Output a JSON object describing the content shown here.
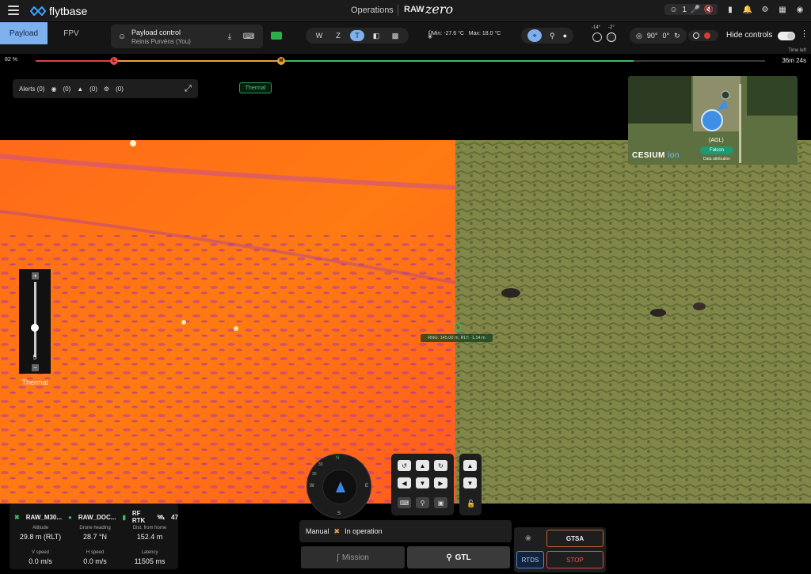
{
  "header": {
    "brand": "flytbase",
    "section": "Operations",
    "drone_prefix": "RAW",
    "drone_name": "zero",
    "user_count": "1"
  },
  "tabs": [
    {
      "label": "Payload",
      "active": true
    },
    {
      "label": "FPV",
      "active": false
    }
  ],
  "payload": {
    "title": "Payload control",
    "user": "Reinis Purvēns (You)"
  },
  "camera_modes": [
    "W",
    "Z",
    "T"
  ],
  "camera_mode_selected": "T",
  "temperature": {
    "min": "Min: -27.6 °C",
    "max": "Max: 18.0 °C"
  },
  "gimbal": {
    "pitch": "-14°",
    "yaw": "-2°",
    "angle1": "90°",
    "angle2": "0°"
  },
  "hide_controls": "Hide controls",
  "progress": {
    "battery_pct": "82 %",
    "marker_low": "L",
    "marker_mid": "M",
    "time_left_label": "Time left",
    "time_left": "36m 24s"
  },
  "alerts": {
    "label": "Alerts (0)",
    "c1": "(0)",
    "c2": "(0)",
    "c3": "(0)"
  },
  "thermal_badge": "Thermal",
  "minimap": {
    "provider": "CESIUM",
    "provider_suffix": "ion",
    "altitude_tag": "(AGL)",
    "drone_label": "Falcon",
    "attribution": "Data attribution"
  },
  "zoom": {
    "value": "5",
    "label": "Thermal",
    "plus": "+",
    "minus": "−"
  },
  "rng_readout": "RNG: 145.00 m, RLT: -1.14 m",
  "telemetry": {
    "drone1": "RAW_M30...",
    "drone2": "RAW_DOC...",
    "link": "RF RTK",
    "satellites": "47",
    "altitude_label": "Altitude",
    "altitude": "29.8 m (RLT)",
    "heading_label": "Drone heading",
    "heading": "28.7 °N",
    "dist_label": "Dist. from home",
    "dist": "152.4 m",
    "vspeed_label": "V speed",
    "vspeed": "0.0 m/s",
    "hspeed_label": "H speed",
    "hspeed": "0.0 m/s",
    "latency_label": "Latency",
    "latency": "11505 ms"
  },
  "compass": {
    "north": "N",
    "e": "E",
    "s": "S",
    "w": "W",
    "d30": "30",
    "d33": "33"
  },
  "status": {
    "mode": "Manual",
    "state": "In operation"
  },
  "actions": {
    "mission": "Mission",
    "gtl": "GTL",
    "gtsa": "GTSA",
    "stop": "STOP",
    "rtds": "RTDS"
  },
  "colors": {
    "accent": "#7fb0ee",
    "green": "#3cbc63",
    "red": "#d64545",
    "yellow": "#e8a23a"
  }
}
